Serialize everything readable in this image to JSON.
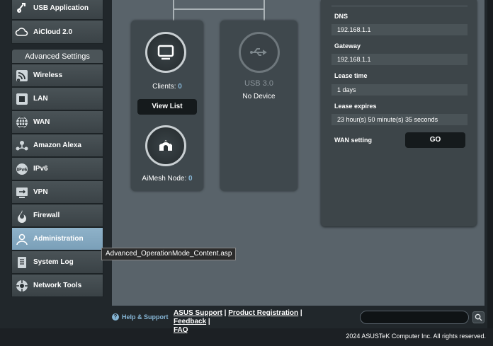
{
  "sidebar": {
    "top_items": [
      {
        "label": "USB Application",
        "icon": "usb-puzzle-icon"
      },
      {
        "label": "AiCloud 2.0",
        "icon": "cloud-icon"
      }
    ],
    "advanced_header": "Advanced Settings",
    "items": [
      {
        "label": "Wireless",
        "icon": "wireless-icon"
      },
      {
        "label": "LAN",
        "icon": "lan-icon"
      },
      {
        "label": "WAN",
        "icon": "globe-icon"
      },
      {
        "label": "Amazon Alexa",
        "icon": "alexa-icon"
      },
      {
        "label": "IPv6",
        "icon": "ipv6-icon"
      },
      {
        "label": "VPN",
        "icon": "vpn-icon"
      },
      {
        "label": "Firewall",
        "icon": "firewall-icon"
      },
      {
        "label": "Administration",
        "icon": "administration-icon",
        "active": true
      },
      {
        "label": "System Log",
        "icon": "system-log-icon"
      },
      {
        "label": "Network Tools",
        "icon": "network-tools-icon"
      }
    ]
  },
  "network_map": {
    "clients_label": "Clients:",
    "clients_count": "0",
    "view_list_label": "View List",
    "aimesh_label": "AiMesh Node:",
    "aimesh_count": "0",
    "usb_title": "USB 3.0",
    "usb_status": "No Device"
  },
  "wan_panel": {
    "dns_label": "DNS",
    "dns_value": "192.168.1.1",
    "gateway_label": "Gateway",
    "gateway_value": "192.168.1.1",
    "lease_time_label": "Lease time",
    "lease_time_value": "1 days",
    "lease_expires_label": "Lease expires",
    "lease_expires_value": "23 hour(s) 50 minute(s) 35 seconds",
    "wan_setting_label": "WAN setting",
    "go_label": "GO"
  },
  "footer": {
    "help_label": "Help & Support",
    "asus_support": "ASUS Support",
    "product_registration": "Product Registration",
    "feedback": "Feedback",
    "faq": "FAQ",
    "separator": " | ",
    "copyright": "2024 ASUSTeK Computer Inc. All rights reserved."
  },
  "tooltip": "Advanced_OperationMode_Content.asp",
  "colors": {
    "accent_blue": "#86b6d6",
    "active_menu": "#8fb2c9",
    "content_bg": "#59636a"
  }
}
